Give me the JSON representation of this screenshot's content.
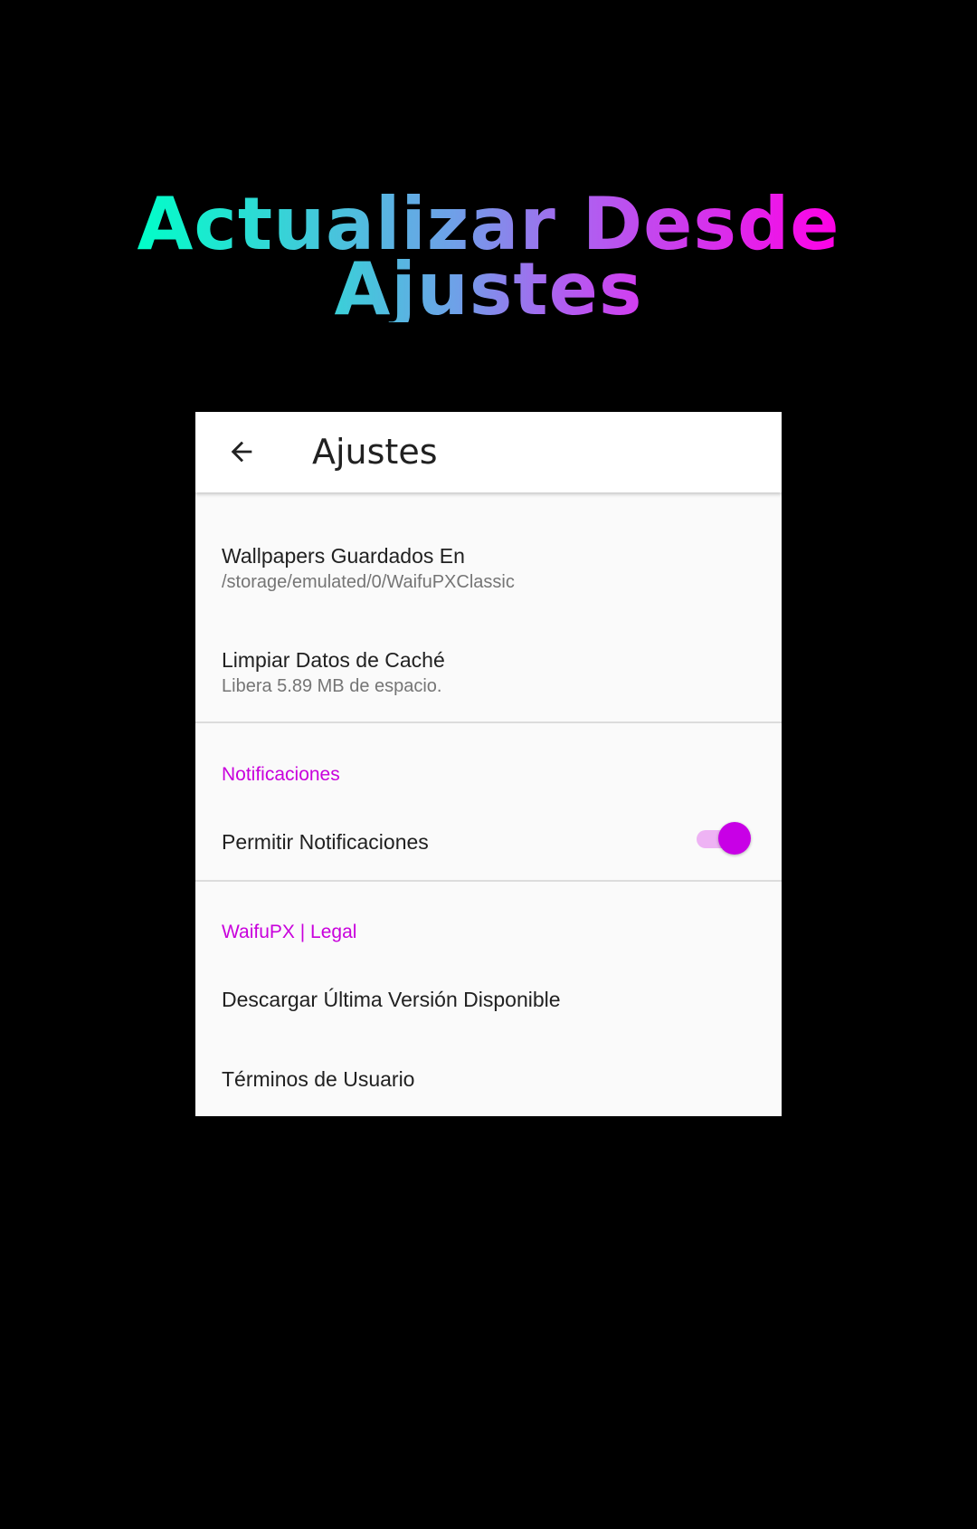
{
  "promo": {
    "line1": "Actualizar Desde",
    "line2": "Ajustes"
  },
  "appbar": {
    "back_icon": "arrow-back-icon",
    "title": "Ajustes"
  },
  "storage": {
    "title": "Wallpapers Guardados En",
    "summary": "/storage/emulated/0/WaifuPXClassic"
  },
  "cache": {
    "title": "Limpiar Datos de Caché",
    "summary": "Libera 5.89 MB de espacio."
  },
  "notifications": {
    "category": "Notificaciones",
    "allow_title": "Permitir Notificaciones",
    "allow_enabled": true
  },
  "legal": {
    "category": "WaifuPX | Legal",
    "download_title": "Descargar Última Versión Disponible",
    "terms_title": "Términos de Usuario"
  },
  "colors": {
    "accent": "#c800e6",
    "accent_track": "#eeb3f4",
    "background": "#000000",
    "surface": "#fafafa",
    "gradient_start": "#00ffc8",
    "gradient_end": "#ff00e6"
  }
}
